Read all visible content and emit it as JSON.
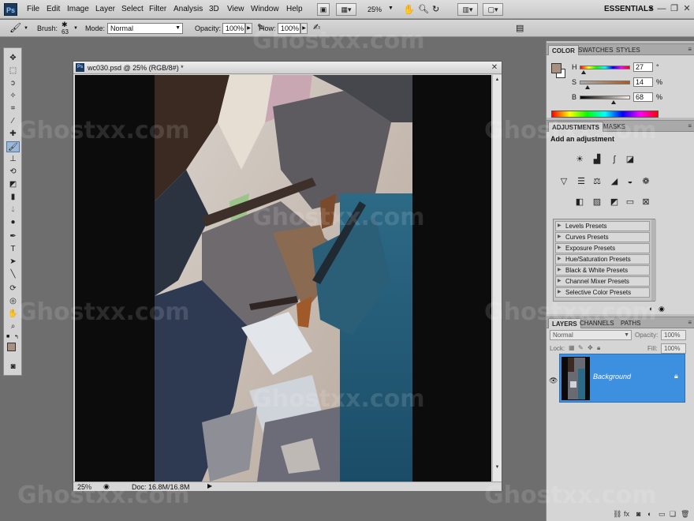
{
  "app": {
    "logo_text": "Ps"
  },
  "menu": [
    "File",
    "Edit",
    "Image",
    "Layer",
    "Select",
    "Filter",
    "Analysis",
    "3D",
    "View",
    "Window",
    "Help"
  ],
  "menubar": {
    "zoom_value": "25%",
    "workspace": "ESSENTIALS",
    "minimize": "—",
    "restore": "❐",
    "close": "✕"
  },
  "options": {
    "brush_label": "Brush:",
    "brush_size": "63",
    "mode_label": "Mode:",
    "mode_value": "Normal",
    "opacity_label": "Opacity:",
    "opacity_value": "100%",
    "flow_label": "Flow:",
    "flow_value": "100%"
  },
  "document": {
    "title": "wc030.psd @ 25% (RGB/8#) *",
    "zoom": "25%",
    "doc_size": "Doc: 16.8M/16.8M"
  },
  "color_panel": {
    "tabs": [
      "COLOR",
      "SWATCHES",
      "STYLES"
    ],
    "channels": [
      {
        "label": "H",
        "value": "27",
        "unit": "°",
        "fraction": 0.07
      },
      {
        "label": "S",
        "value": "14",
        "unit": "%",
        "fraction": 0.14
      },
      {
        "label": "B",
        "value": "68",
        "unit": "%",
        "fraction": 0.68
      }
    ],
    "foreground": "#a89080",
    "background": "#ffffff"
  },
  "adjustments_panel": {
    "tabs": [
      "ADJUSTMENTS",
      "MASKS"
    ],
    "heading": "Add an adjustment",
    "presets": [
      "Levels Presets",
      "Curves Presets",
      "Exposure Presets",
      "Hue/Saturation Presets",
      "Black & White Presets",
      "Channel Mixer Presets",
      "Selective Color Presets"
    ]
  },
  "layers_panel": {
    "tabs": [
      "LAYERS",
      "CHANNELS",
      "PATHS"
    ],
    "blend_mode": "Normal",
    "opacity_label": "Opacity:",
    "opacity_value": "100%",
    "lock_label": "Lock:",
    "fill_label": "Fill:",
    "fill_value": "100%",
    "layer_name": "Background",
    "selection_color": "#3d8fe0"
  },
  "watermark": {
    "text": "Ghostxx.com"
  }
}
